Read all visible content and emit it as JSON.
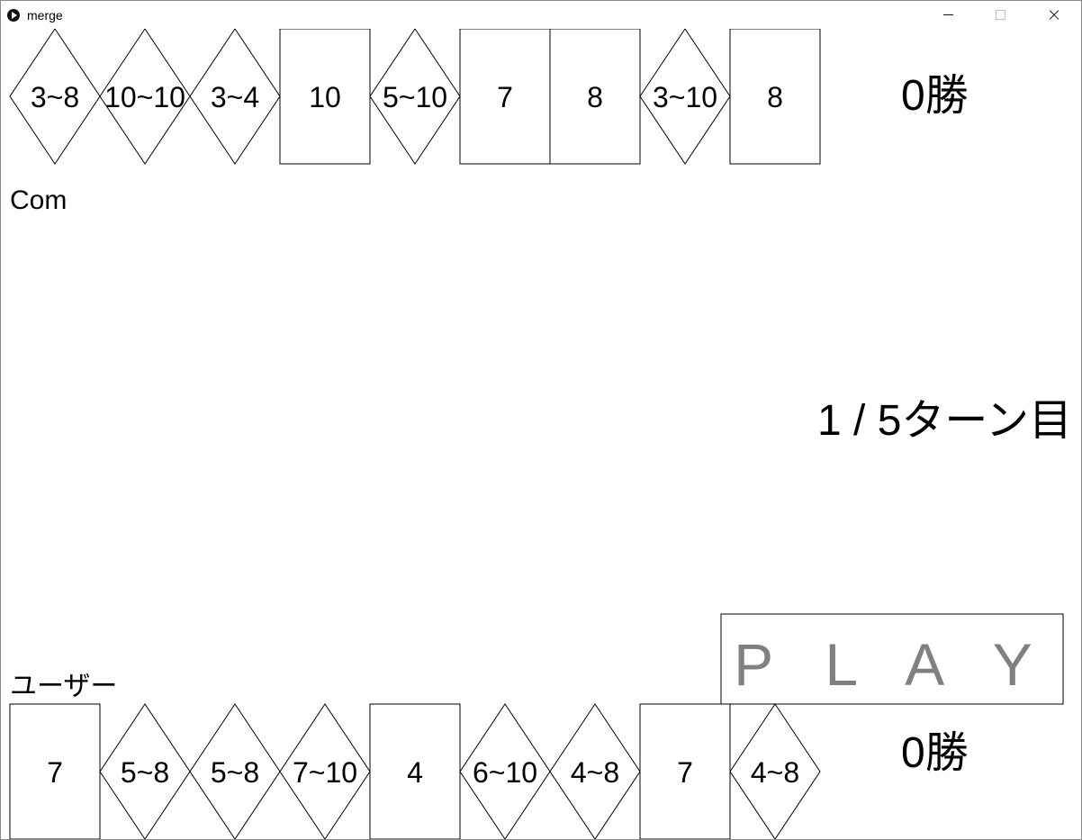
{
  "window": {
    "title": "merge",
    "app_icon": "play-icon",
    "controls": [
      "minimize-icon",
      "maximize-icon",
      "close-icon"
    ]
  },
  "com": {
    "label": "Com",
    "wins": "0勝",
    "cards": [
      {
        "shape": "diamond",
        "label": "3~8"
      },
      {
        "shape": "diamond",
        "label": "10~10"
      },
      {
        "shape": "diamond",
        "label": "3~4"
      },
      {
        "shape": "rect",
        "label": "10"
      },
      {
        "shape": "diamond",
        "label": "5~10"
      },
      {
        "shape": "rect",
        "label": "7"
      },
      {
        "shape": "rect",
        "label": "8"
      },
      {
        "shape": "diamond",
        "label": "3~10"
      },
      {
        "shape": "rect",
        "label": "8"
      }
    ]
  },
  "turn": "1 / 5ターン目",
  "play_button": "P L A Y",
  "user": {
    "label": "ユーザー",
    "wins": "0勝",
    "cards": [
      {
        "shape": "rect",
        "label": "7"
      },
      {
        "shape": "diamond",
        "label": "5~8"
      },
      {
        "shape": "diamond",
        "label": "5~8"
      },
      {
        "shape": "diamond",
        "label": "7~10"
      },
      {
        "shape": "rect",
        "label": "4"
      },
      {
        "shape": "diamond",
        "label": "6~10"
      },
      {
        "shape": "diamond",
        "label": "4~8"
      },
      {
        "shape": "rect",
        "label": "7"
      },
      {
        "shape": "diamond",
        "label": "4~8"
      }
    ]
  },
  "colors": {
    "background": "#ffffff",
    "stroke": "#000000",
    "play_text": "#808080"
  }
}
